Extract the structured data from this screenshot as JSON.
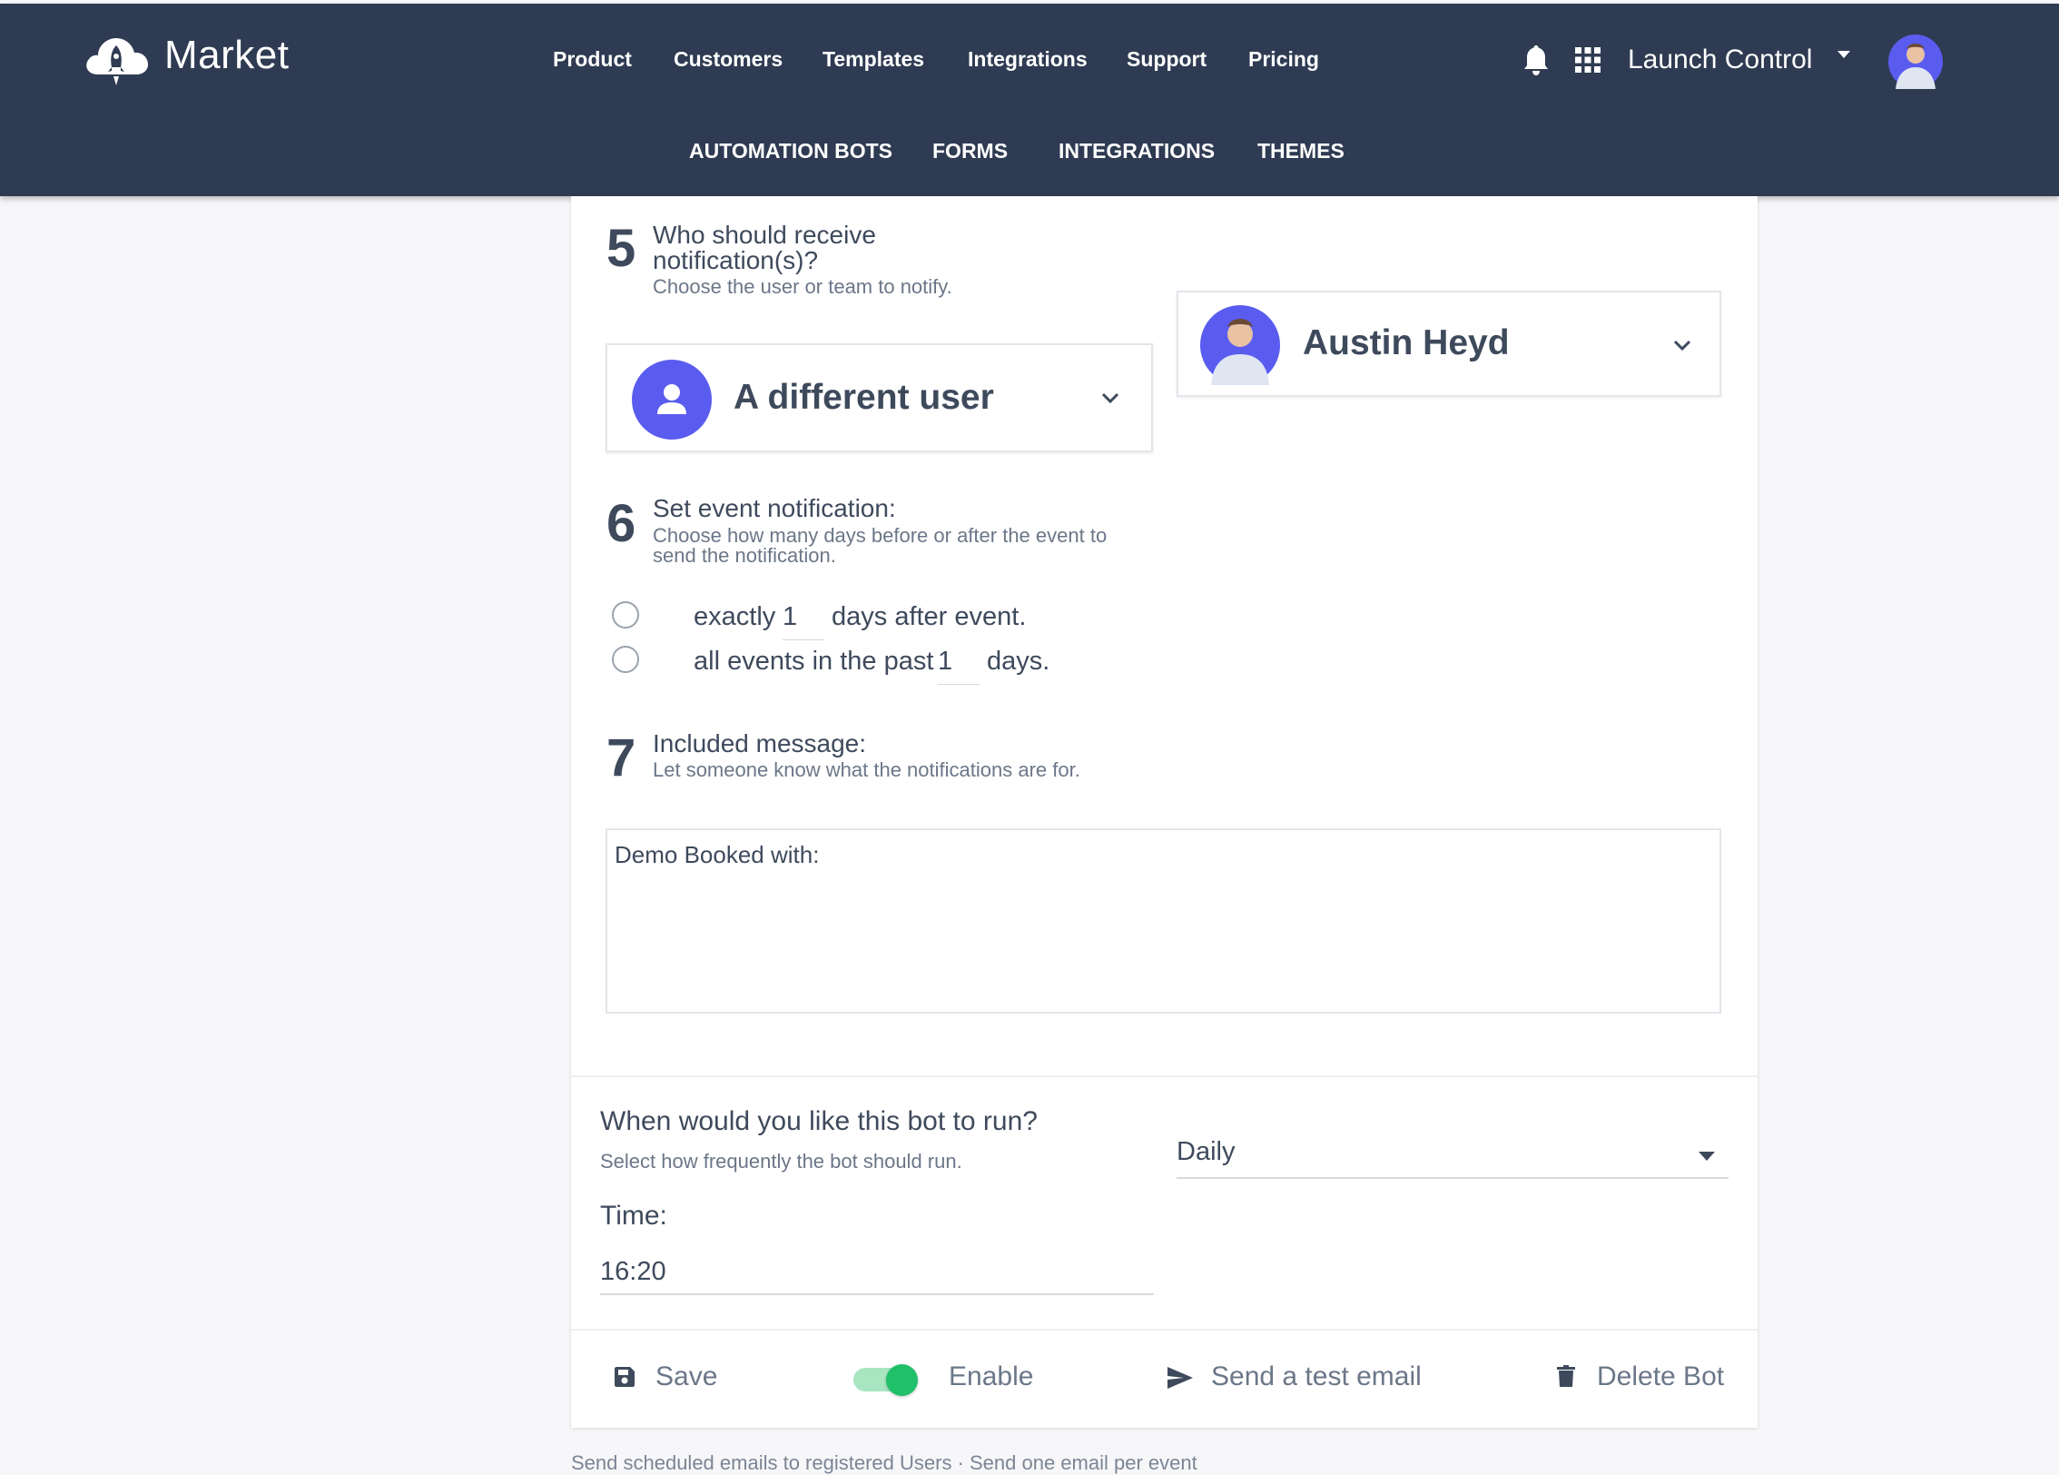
{
  "brand": {
    "name": "Market"
  },
  "topnav": [
    "Product",
    "Customers",
    "Templates",
    "Integrations",
    "Support",
    "Pricing"
  ],
  "subnav": [
    "AUTOMATION BOTS",
    "FORMS",
    "INTEGRATIONS",
    "THEMES"
  ],
  "account": {
    "name": "Launch Control"
  },
  "step5": {
    "number": "5",
    "title_line1": "Who should receive",
    "title_line2": "notification(s)?",
    "subtitle": "Choose the user or team to notify.",
    "recipient_type": "A different user",
    "selected_user": "Austin Heyd"
  },
  "step6": {
    "number": "6",
    "title": "Set event notification:",
    "subtitle_line1": "Choose how many days before or after the event to",
    "subtitle_line2": "send the notification.",
    "option1": {
      "prefix": "exactly",
      "value": "1",
      "suffix": "days after event."
    },
    "option2": {
      "prefix": "all events in the past",
      "value": "1",
      "suffix": "days."
    }
  },
  "step7": {
    "number": "7",
    "title": "Included message:",
    "subtitle": "Let someone know what the notifications are for.",
    "message": "Demo Booked with:"
  },
  "schedule": {
    "title": "When would you like this bot to run?",
    "subtitle": "Select how frequently the bot should run.",
    "frequency": "Daily",
    "time_label": "Time:",
    "time_value": "16:20"
  },
  "footer": {
    "save": "Save",
    "enable": "Enable",
    "enabled": true,
    "test_email": "Send a test email",
    "delete": "Delete Bot"
  },
  "bottom_note": "Send scheduled emails to registered Users · Send one email per event",
  "colors": {
    "header_bg": "#2f3b52",
    "accent": "#5a5cf0",
    "toggle_on": "#20c06a"
  },
  "icons": [
    "cloud-rocket-logo-icon",
    "bell-icon",
    "apps-grid-icon",
    "caret-down-icon",
    "user-icon",
    "chevron-down-icon",
    "save-icon",
    "send-icon",
    "trash-icon"
  ]
}
